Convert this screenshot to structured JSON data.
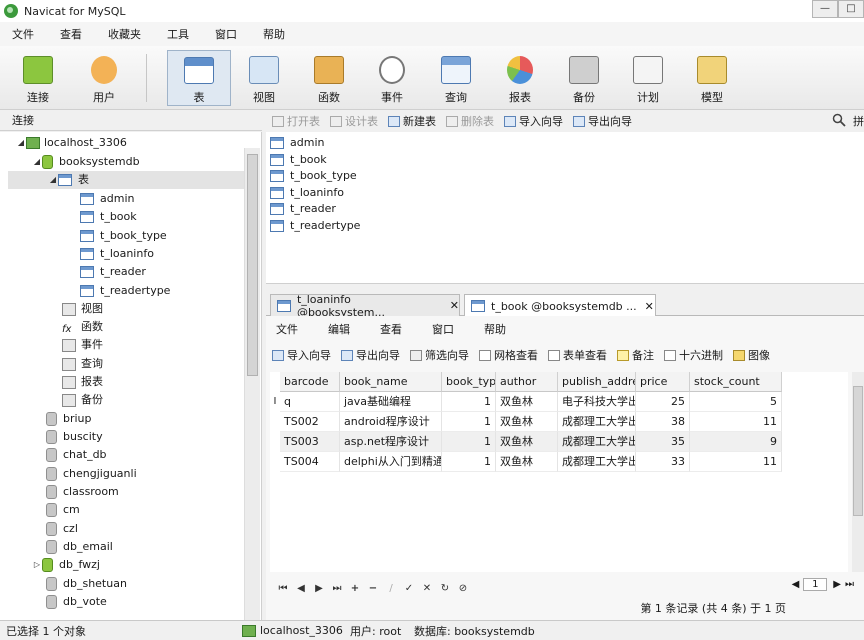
{
  "window": {
    "title": "Navicat for MySQL",
    "min": "—",
    "max": "□"
  },
  "menubar": [
    "文件",
    "查看",
    "收藏夹",
    "工具",
    "窗口",
    "帮助"
  ],
  "toolbar": [
    "连接",
    "用户",
    "表",
    "视图",
    "函数",
    "事件",
    "查询",
    "报表",
    "备份",
    "计划",
    "模型"
  ],
  "colors": {
    "selected": "#dfe8f2",
    "accent": "#4d79b1",
    "tree_db": "#8cc63f"
  },
  "panel": {
    "connection_title": "连接"
  },
  "object_toolbar": {
    "open": "打开表",
    "design": "设计表",
    "new": "新建表",
    "delete": "删除表",
    "import": "导入向导",
    "export": "导出向导",
    "more": "拼"
  },
  "tree": {
    "connection": "localhost_3306",
    "database": "booksystemdb",
    "tables_node": "表",
    "tables": [
      "admin",
      "t_book",
      "t_book_type",
      "t_loaninfo",
      "t_reader",
      "t_readertype"
    ],
    "categories": [
      "视图",
      "函数",
      "事件",
      "查询",
      "报表",
      "备份"
    ],
    "other_dbs": [
      "briup",
      "buscity",
      "chat_db",
      "chengjiguanli",
      "classroom",
      "cm",
      "czl",
      "db_email",
      "db_fwzj",
      "db_shetuan",
      "db_vote"
    ]
  },
  "object_list": [
    "admin",
    "t_book",
    "t_book_type",
    "t_loaninfo",
    "t_reader",
    "t_readertype"
  ],
  "tabs": [
    {
      "label": "t_loaninfo @booksystem...",
      "close": "✕"
    },
    {
      "label": "t_book @booksystemdb ...",
      "close": "✕"
    }
  ],
  "editor_menu": [
    "文件",
    "编辑",
    "查看",
    "窗口",
    "帮助"
  ],
  "editor_toolbar": [
    "导入向导",
    "导出向导",
    "筛选向导",
    "网格查看",
    "表单查看",
    "备注",
    "十六进制",
    "图像"
  ],
  "grid": {
    "columns": [
      "barcode",
      "book_name",
      "book_typ",
      "author",
      "publish_addre",
      "price",
      "stock_count"
    ],
    "rows": [
      [
        "q",
        "java基础编程",
        "1",
        "双鱼林",
        "电子科技大学出",
        "25",
        "5"
      ],
      [
        "TS002",
        "android程序设计",
        "1",
        "双鱼林",
        "成都理工大学出",
        "38",
        "11"
      ],
      [
        "TS003",
        "asp.net程序设计",
        "1",
        "双鱼林",
        "成都理工大学出",
        "35",
        "9"
      ],
      [
        "TS004",
        "delphi从入门到精通",
        "1",
        "双鱼林",
        "成都理工大学出",
        "33",
        "11"
      ]
    ],
    "row_indicator": "I"
  },
  "nav_buttons": [
    "⏮",
    "◀",
    "▶",
    "⏭",
    "+",
    "−",
    "/",
    "✓",
    "✕",
    "↻",
    "⊘"
  ],
  "page": {
    "current": "1",
    "prev": "◀",
    "next": "▶",
    "last": "⏭"
  },
  "record_status": "第 1 条记录 (共 4 条) 于 1 页",
  "status": {
    "selected": "已选择 1 个对象",
    "connection": "localhost_3306",
    "user": "用户: root",
    "database": "数据库: booksystemdb"
  }
}
